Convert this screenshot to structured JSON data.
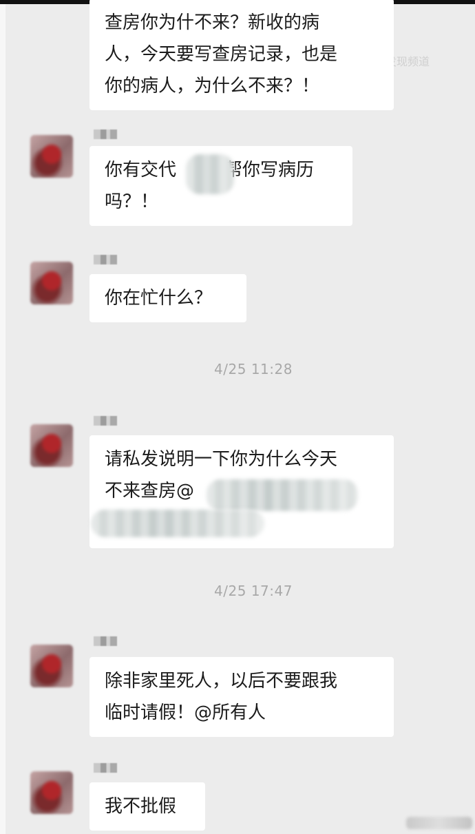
{
  "watermark": "发现频道",
  "messages": [
    {
      "text": "查房你为什不来？新收的病\n人，今天要写查房记录，也是\n你的病人，为什么不来？！"
    },
    {
      "text": "你有交代",
      "text_after": "帮你写病历\n吗？！"
    },
    {
      "text": "你在忙什么？"
    },
    {
      "time": "4/25 11:28"
    },
    {
      "text": "请私发说明一下你为什么今天\n不来查房@"
    },
    {
      "time": "4/25 17:47"
    },
    {
      "text": "除非家里死人，以后不要跟我\n临时请假！@所有人"
    },
    {
      "text": "我不批假"
    }
  ]
}
